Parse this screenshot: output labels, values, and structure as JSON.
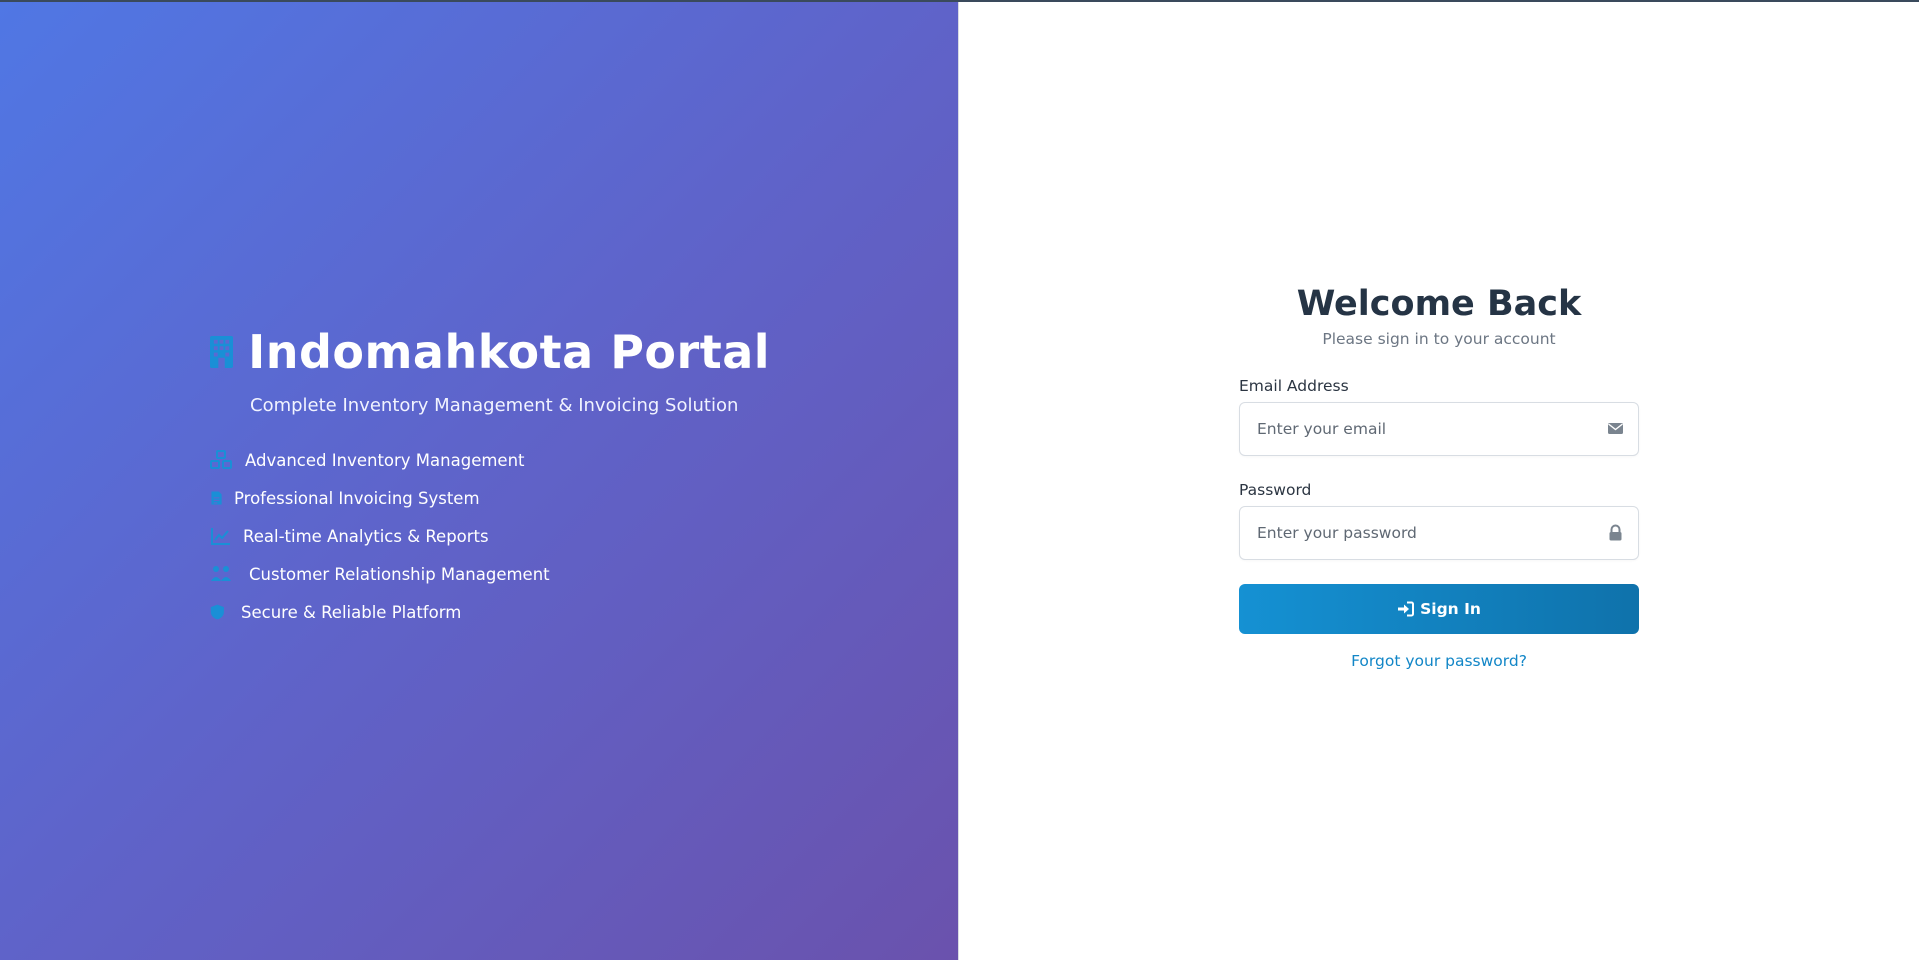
{
  "brand": {
    "title": "Indomahkota Portal",
    "tagline": "Complete Inventory Management & Invoicing Solution",
    "logo_icon": "building-icon",
    "features": [
      {
        "label": "Advanced Inventory Management",
        "icon": "boxes-icon"
      },
      {
        "label": "Professional Invoicing System",
        "icon": "file-invoice-icon"
      },
      {
        "label": "Real-time Analytics & Reports",
        "icon": "chart-line-icon"
      },
      {
        "label": "Customer Relationship Management",
        "icon": "users-icon"
      },
      {
        "label": "Secure & Reliable Platform",
        "icon": "shield-icon"
      }
    ]
  },
  "login": {
    "heading": "Welcome Back",
    "subheading": "Please sign in to your account",
    "email": {
      "label": "Email Address",
      "placeholder": "Enter your email",
      "value": "",
      "icon": "envelope-icon"
    },
    "password": {
      "label": "Password",
      "placeholder": "Enter your password",
      "value": "",
      "icon": "lock-icon"
    },
    "submit_label": "Sign In",
    "submit_icon": "sign-in-icon",
    "forgot_label": "Forgot your password?"
  },
  "colors": {
    "gradient_start": "#5077e4",
    "gradient_end": "#6a52ad",
    "accent": "#1591d3",
    "icon_accent": "#1a8fd6",
    "heading": "#253445",
    "link": "#1286c7"
  }
}
